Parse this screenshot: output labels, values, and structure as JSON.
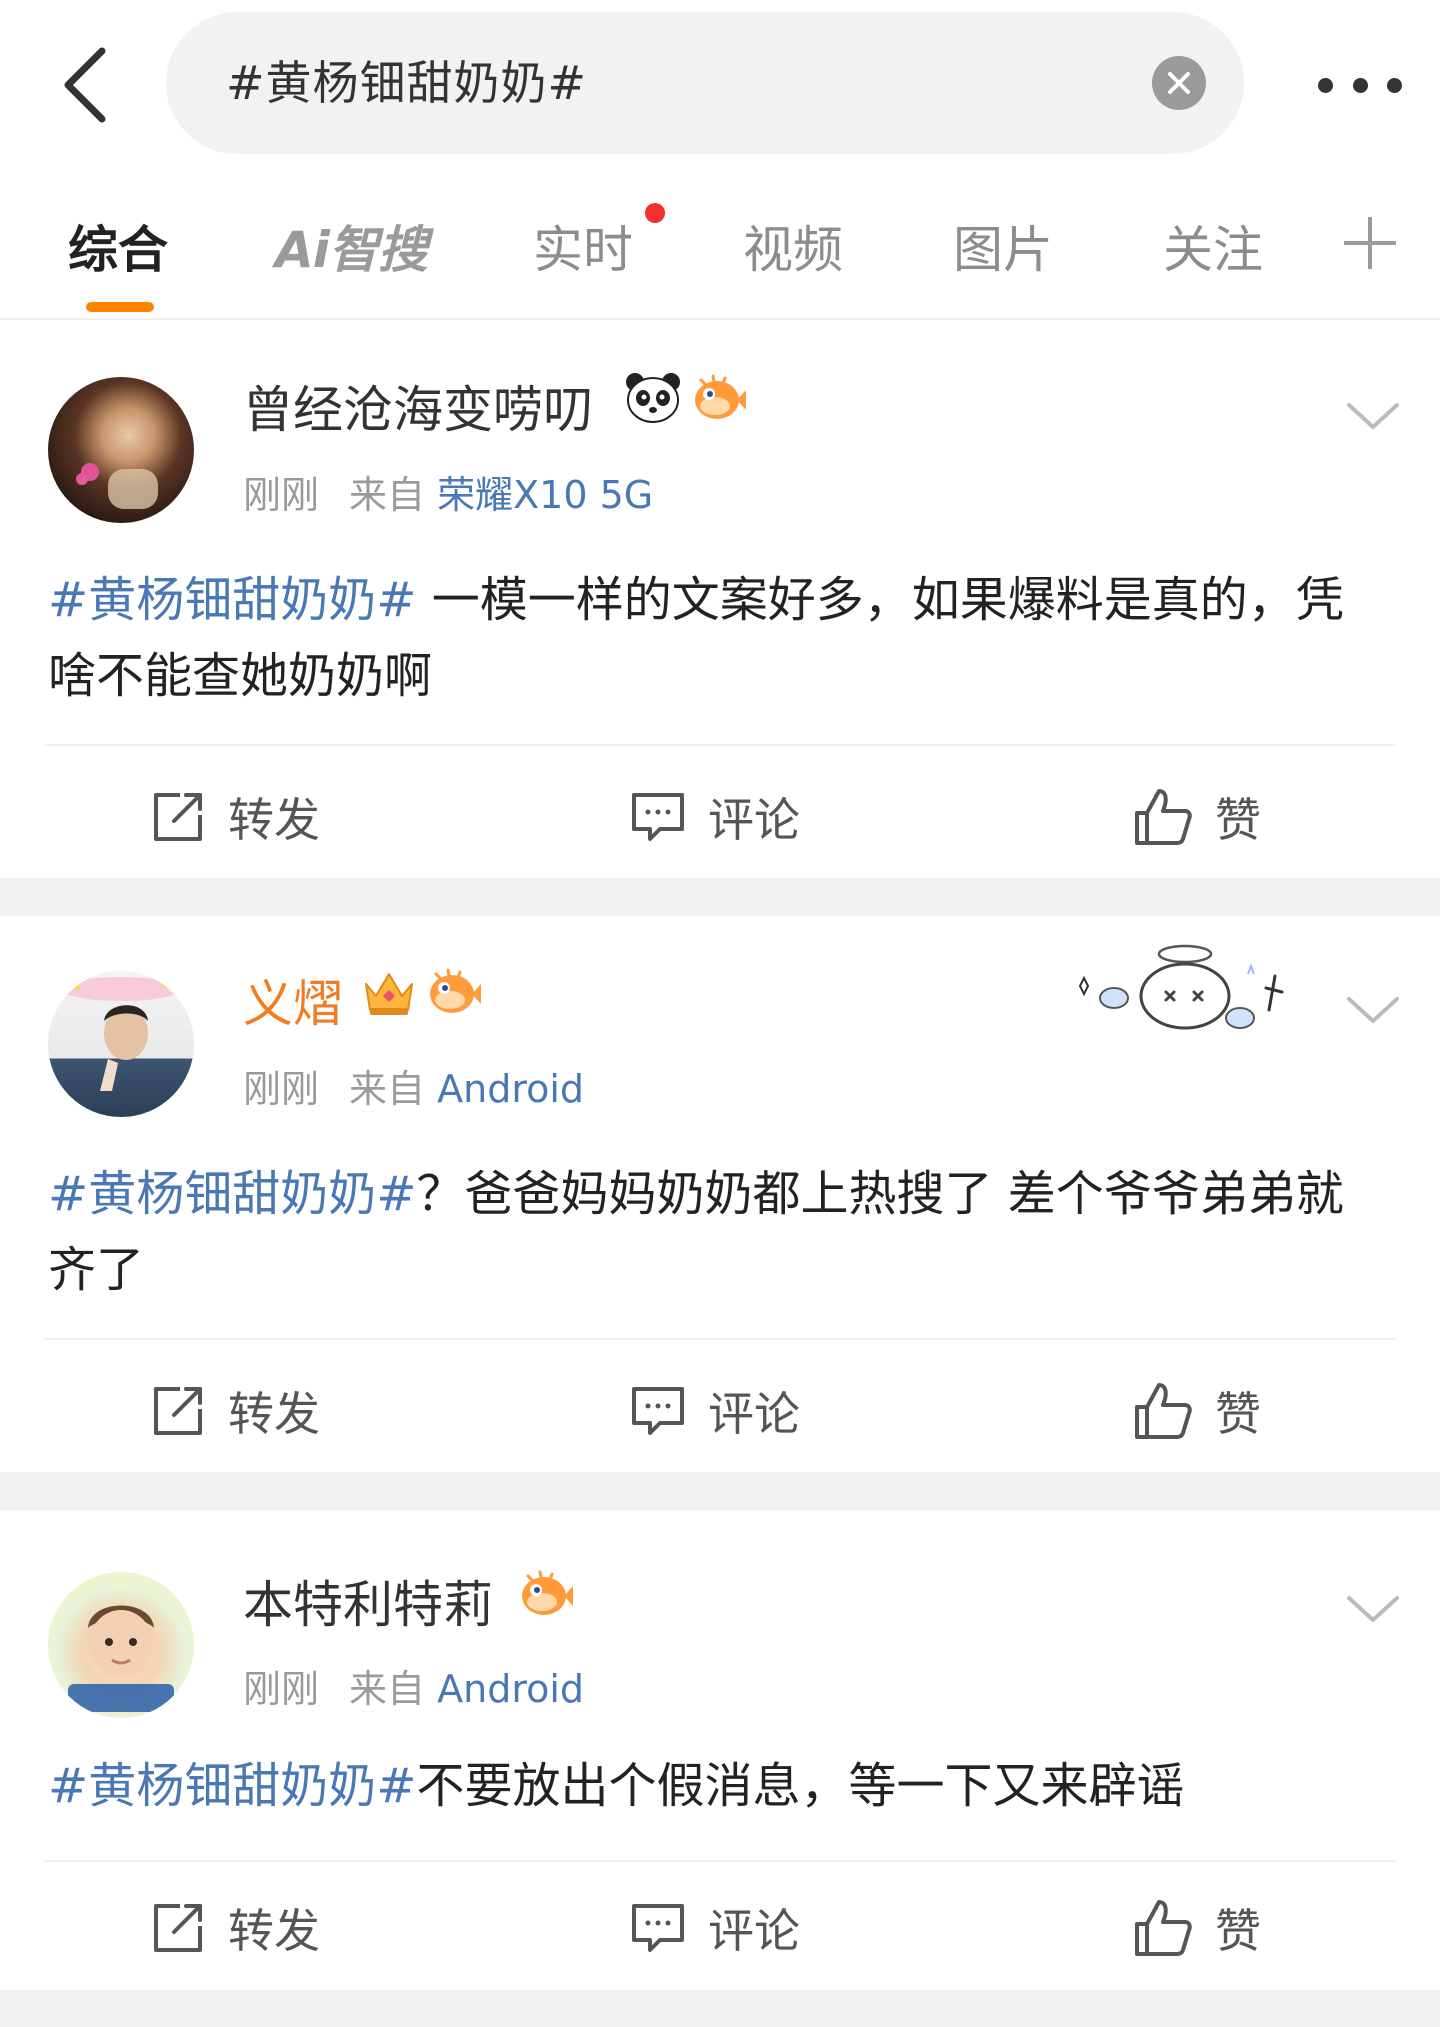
{
  "search": {
    "query": "#黄杨钿甜奶奶#"
  },
  "tabs": [
    {
      "label": "综合"
    },
    {
      "label": "Ai智搜"
    },
    {
      "label": "实时"
    },
    {
      "label": "视频"
    },
    {
      "label": "图片"
    },
    {
      "label": "关注"
    }
  ],
  "actions": {
    "repost": "转发",
    "comment": "评论",
    "like": "赞"
  },
  "posts": [
    {
      "username": "曾经沧海变唠叨",
      "time": "刚刚",
      "from_label": "来自",
      "device": "荣耀X10 5G",
      "hashtag": "#黄杨钿甜奶奶#",
      "text": " 一模一样的文案好多，如果爆料是真的，凭啥不能查她奶奶啊",
      "badges": [
        "panda-icon",
        "pufferfish-icon"
      ]
    },
    {
      "username": "义熠",
      "time": "刚刚",
      "from_label": "来自",
      "device": "Android",
      "hashtag": "#黄杨钿甜奶奶#",
      "text": "？爸爸妈妈奶奶都上热搜了 差个爷爷弟弟就齐了",
      "badges": [
        "crown-icon",
        "pufferfish-icon"
      ]
    },
    {
      "username": "本特利特莉",
      "time": "刚刚",
      "from_label": "来自",
      "device": "Android",
      "hashtag": "#黄杨钿甜奶奶#",
      "text": "不要放出个假消息，等一下又来辟谣",
      "badges": [
        "pufferfish-icon"
      ]
    }
  ],
  "colors": {
    "accent": "#ff8200",
    "link": "#4a78b5",
    "vip_name": "#f47b20",
    "notice_dot": "#f23030"
  }
}
